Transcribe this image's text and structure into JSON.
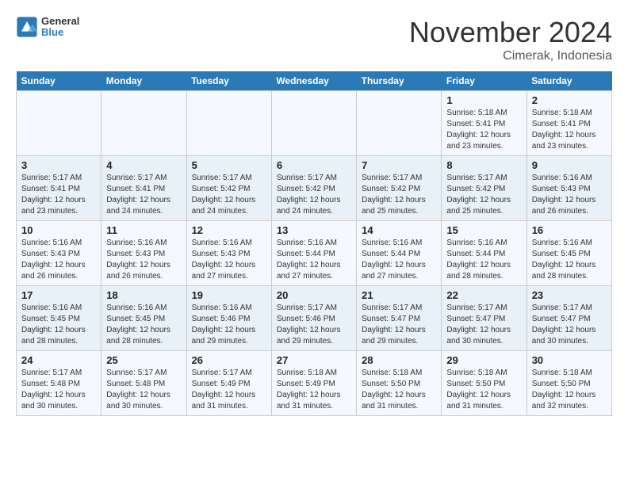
{
  "header": {
    "logo_line1": "General",
    "logo_line2": "Blue",
    "title": "November 2024",
    "subtitle": "Cimerak, Indonesia"
  },
  "weekdays": [
    "Sunday",
    "Monday",
    "Tuesday",
    "Wednesday",
    "Thursday",
    "Friday",
    "Saturday"
  ],
  "weeks": [
    [
      {
        "day": "",
        "info": ""
      },
      {
        "day": "",
        "info": ""
      },
      {
        "day": "",
        "info": ""
      },
      {
        "day": "",
        "info": ""
      },
      {
        "day": "",
        "info": ""
      },
      {
        "day": "1",
        "info": "Sunrise: 5:18 AM\nSunset: 5:41 PM\nDaylight: 12 hours\nand 23 minutes."
      },
      {
        "day": "2",
        "info": "Sunrise: 5:18 AM\nSunset: 5:41 PM\nDaylight: 12 hours\nand 23 minutes."
      }
    ],
    [
      {
        "day": "3",
        "info": "Sunrise: 5:17 AM\nSunset: 5:41 PM\nDaylight: 12 hours\nand 23 minutes."
      },
      {
        "day": "4",
        "info": "Sunrise: 5:17 AM\nSunset: 5:41 PM\nDaylight: 12 hours\nand 24 minutes."
      },
      {
        "day": "5",
        "info": "Sunrise: 5:17 AM\nSunset: 5:42 PM\nDaylight: 12 hours\nand 24 minutes."
      },
      {
        "day": "6",
        "info": "Sunrise: 5:17 AM\nSunset: 5:42 PM\nDaylight: 12 hours\nand 24 minutes."
      },
      {
        "day": "7",
        "info": "Sunrise: 5:17 AM\nSunset: 5:42 PM\nDaylight: 12 hours\nand 25 minutes."
      },
      {
        "day": "8",
        "info": "Sunrise: 5:17 AM\nSunset: 5:42 PM\nDaylight: 12 hours\nand 25 minutes."
      },
      {
        "day": "9",
        "info": "Sunrise: 5:16 AM\nSunset: 5:43 PM\nDaylight: 12 hours\nand 26 minutes."
      }
    ],
    [
      {
        "day": "10",
        "info": "Sunrise: 5:16 AM\nSunset: 5:43 PM\nDaylight: 12 hours\nand 26 minutes."
      },
      {
        "day": "11",
        "info": "Sunrise: 5:16 AM\nSunset: 5:43 PM\nDaylight: 12 hours\nand 26 minutes."
      },
      {
        "day": "12",
        "info": "Sunrise: 5:16 AM\nSunset: 5:43 PM\nDaylight: 12 hours\nand 27 minutes."
      },
      {
        "day": "13",
        "info": "Sunrise: 5:16 AM\nSunset: 5:44 PM\nDaylight: 12 hours\nand 27 minutes."
      },
      {
        "day": "14",
        "info": "Sunrise: 5:16 AM\nSunset: 5:44 PM\nDaylight: 12 hours\nand 27 minutes."
      },
      {
        "day": "15",
        "info": "Sunrise: 5:16 AM\nSunset: 5:44 PM\nDaylight: 12 hours\nand 28 minutes."
      },
      {
        "day": "16",
        "info": "Sunrise: 5:16 AM\nSunset: 5:45 PM\nDaylight: 12 hours\nand 28 minutes."
      }
    ],
    [
      {
        "day": "17",
        "info": "Sunrise: 5:16 AM\nSunset: 5:45 PM\nDaylight: 12 hours\nand 28 minutes."
      },
      {
        "day": "18",
        "info": "Sunrise: 5:16 AM\nSunset: 5:45 PM\nDaylight: 12 hours\nand 28 minutes."
      },
      {
        "day": "19",
        "info": "Sunrise: 5:16 AM\nSunset: 5:46 PM\nDaylight: 12 hours\nand 29 minutes."
      },
      {
        "day": "20",
        "info": "Sunrise: 5:17 AM\nSunset: 5:46 PM\nDaylight: 12 hours\nand 29 minutes."
      },
      {
        "day": "21",
        "info": "Sunrise: 5:17 AM\nSunset: 5:47 PM\nDaylight: 12 hours\nand 29 minutes."
      },
      {
        "day": "22",
        "info": "Sunrise: 5:17 AM\nSunset: 5:47 PM\nDaylight: 12 hours\nand 30 minutes."
      },
      {
        "day": "23",
        "info": "Sunrise: 5:17 AM\nSunset: 5:47 PM\nDaylight: 12 hours\nand 30 minutes."
      }
    ],
    [
      {
        "day": "24",
        "info": "Sunrise: 5:17 AM\nSunset: 5:48 PM\nDaylight: 12 hours\nand 30 minutes."
      },
      {
        "day": "25",
        "info": "Sunrise: 5:17 AM\nSunset: 5:48 PM\nDaylight: 12 hours\nand 30 minutes."
      },
      {
        "day": "26",
        "info": "Sunrise: 5:17 AM\nSunset: 5:49 PM\nDaylight: 12 hours\nand 31 minutes."
      },
      {
        "day": "27",
        "info": "Sunrise: 5:18 AM\nSunset: 5:49 PM\nDaylight: 12 hours\nand 31 minutes."
      },
      {
        "day": "28",
        "info": "Sunrise: 5:18 AM\nSunset: 5:50 PM\nDaylight: 12 hours\nand 31 minutes."
      },
      {
        "day": "29",
        "info": "Sunrise: 5:18 AM\nSunset: 5:50 PM\nDaylight: 12 hours\nand 31 minutes."
      },
      {
        "day": "30",
        "info": "Sunrise: 5:18 AM\nSunset: 5:50 PM\nDaylight: 12 hours\nand 32 minutes."
      }
    ]
  ]
}
